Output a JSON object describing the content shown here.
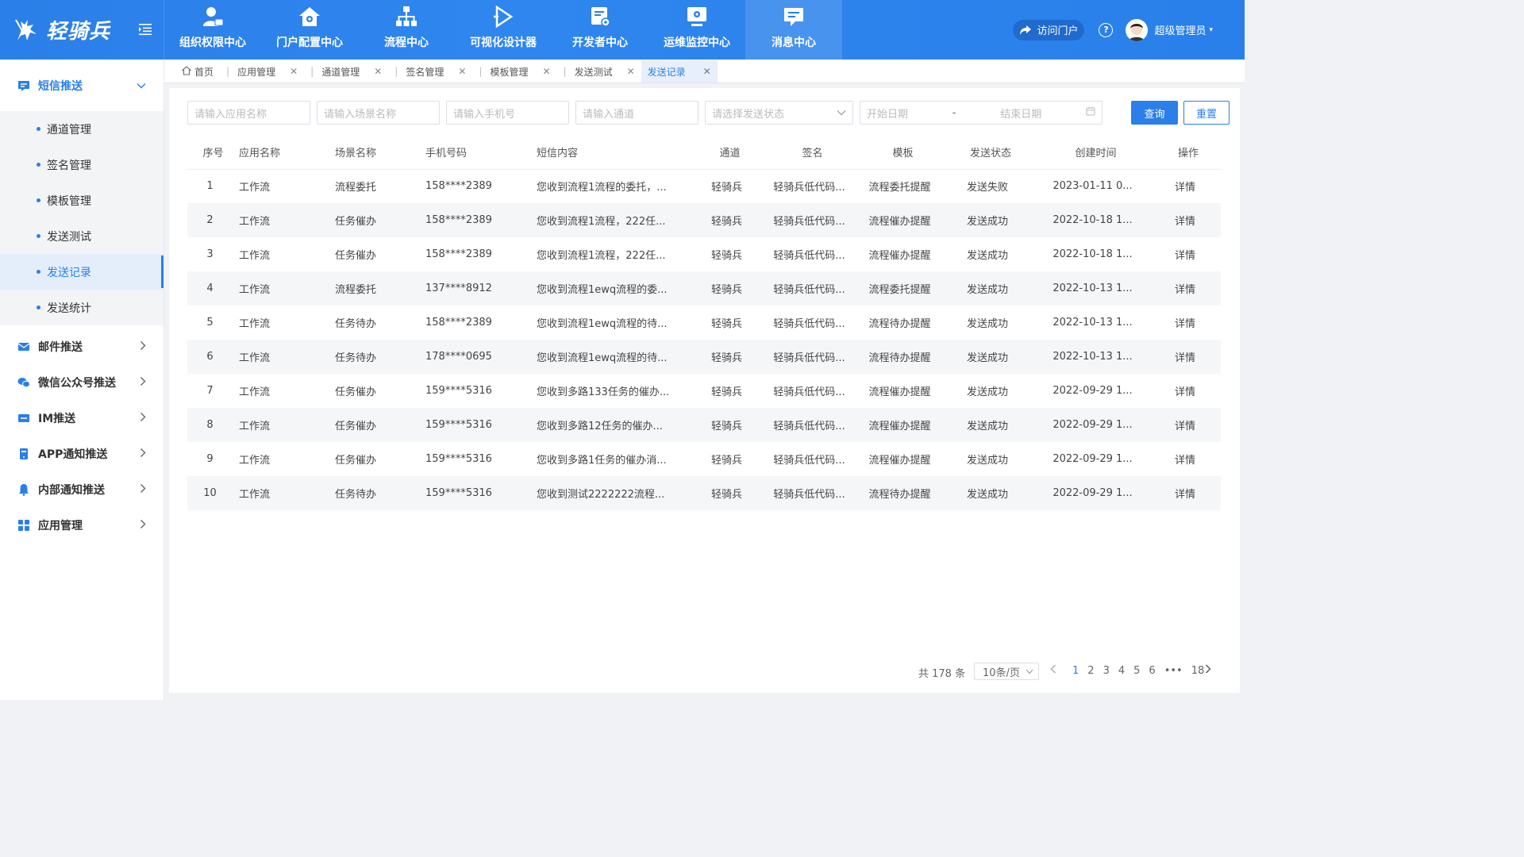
{
  "brand": {
    "name": "轻骑兵"
  },
  "nav": [
    {
      "label": "组织权限中心",
      "icon": "user-lock-icon"
    },
    {
      "label": "门户配置中心",
      "icon": "home-gear-icon"
    },
    {
      "label": "流程中心",
      "icon": "org-tree-icon"
    },
    {
      "label": "可视化设计器",
      "icon": "play-triangle-icon"
    },
    {
      "label": "开发者中心",
      "icon": "doc-gear-icon"
    },
    {
      "label": "运维监控中心",
      "icon": "monitor-gear-icon"
    },
    {
      "label": "消息中心",
      "icon": "message-icon"
    }
  ],
  "top_right": {
    "portal": "访问门户",
    "user": "超级管理员"
  },
  "sidebar": {
    "sms": {
      "label": "短信推送",
      "items": [
        "通道管理",
        "签名管理",
        "模板管理",
        "发送测试",
        "发送记录",
        "发送统计"
      ]
    },
    "others": [
      "邮件推送",
      "微信公众号推送",
      "IM推送",
      "APP通知推送",
      "内部通知推送",
      "应用管理"
    ]
  },
  "tabs": [
    "首页",
    "应用管理",
    "通道管理",
    "签名管理",
    "模板管理",
    "发送测试",
    "发送记录"
  ],
  "filters": {
    "app": "请输入应用名称",
    "scene": "请输入场景名称",
    "phone": "请输入手机号",
    "channel": "请输入通道",
    "status": "请选择发送状态",
    "start": "开始日期",
    "dash": "-",
    "end": "结束日期",
    "query": "查询",
    "reset": "重置"
  },
  "table": {
    "headers": [
      "序号",
      "应用名称",
      "场景名称",
      "手机号码",
      "短信内容",
      "通道",
      "签名",
      "模板",
      "发送状态",
      "创建时间",
      "操作"
    ],
    "rows": [
      [
        "1",
        "工作流",
        "流程委托",
        "158****2389",
        "您收到流程1流程的委托，...",
        "轻骑兵",
        "轻骑兵低代码...",
        "流程委托提醒",
        "发送失败",
        "2023-01-11 0...",
        "详情"
      ],
      [
        "2",
        "工作流",
        "任务催办",
        "158****2389",
        "您收到流程1流程，222任...",
        "轻骑兵",
        "轻骑兵低代码...",
        "流程催办提醒",
        "发送成功",
        "2022-10-18 1...",
        "详情"
      ],
      [
        "3",
        "工作流",
        "任务催办",
        "158****2389",
        "您收到流程1流程，222任...",
        "轻骑兵",
        "轻骑兵低代码...",
        "流程催办提醒",
        "发送成功",
        "2022-10-18 1...",
        "详情"
      ],
      [
        "4",
        "工作流",
        "流程委托",
        "137****8912",
        "您收到流程1ewq流程的委...",
        "轻骑兵",
        "轻骑兵低代码...",
        "流程委托提醒",
        "发送成功",
        "2022-10-13 1...",
        "详情"
      ],
      [
        "5",
        "工作流",
        "任务待办",
        "158****2389",
        "您收到流程1ewq流程的待...",
        "轻骑兵",
        "轻骑兵低代码...",
        "流程待办提醒",
        "发送成功",
        "2022-10-13 1...",
        "详情"
      ],
      [
        "6",
        "工作流",
        "任务待办",
        "178****0695",
        "您收到流程1ewq流程的待...",
        "轻骑兵",
        "轻骑兵低代码...",
        "流程待办提醒",
        "发送成功",
        "2022-10-13 1...",
        "详情"
      ],
      [
        "7",
        "工作流",
        "任务催办",
        "159****5316",
        "您收到多路133任务的催办...",
        "轻骑兵",
        "轻骑兵低代码...",
        "流程催办提醒",
        "发送成功",
        "2022-09-29 1...",
        "详情"
      ],
      [
        "8",
        "工作流",
        "任务催办",
        "159****5316",
        "您收到多路12任务的催办...",
        "轻骑兵",
        "轻骑兵低代码...",
        "流程催办提醒",
        "发送成功",
        "2022-09-29 1...",
        "详情"
      ],
      [
        "9",
        "工作流",
        "任务催办",
        "159****5316",
        "您收到多路1任务的催办消...",
        "轻骑兵",
        "轻骑兵低代码...",
        "流程催办提醒",
        "发送成功",
        "2022-09-29 1...",
        "详情"
      ],
      [
        "10",
        "工作流",
        "任务待办",
        "159****5316",
        "您收到测试2222222流程...",
        "轻骑兵",
        "轻骑兵低代码...",
        "流程待办提醒",
        "发送成功",
        "2022-09-29 1...",
        "详情"
      ]
    ]
  },
  "pager": {
    "total": "共 178 条",
    "size": "10条/页",
    "pages": [
      "1",
      "2",
      "3",
      "4",
      "5",
      "6",
      "•••",
      "18"
    ]
  },
  "colors": {
    "primary": "#2a7fe8",
    "fail": "#e5251c"
  }
}
